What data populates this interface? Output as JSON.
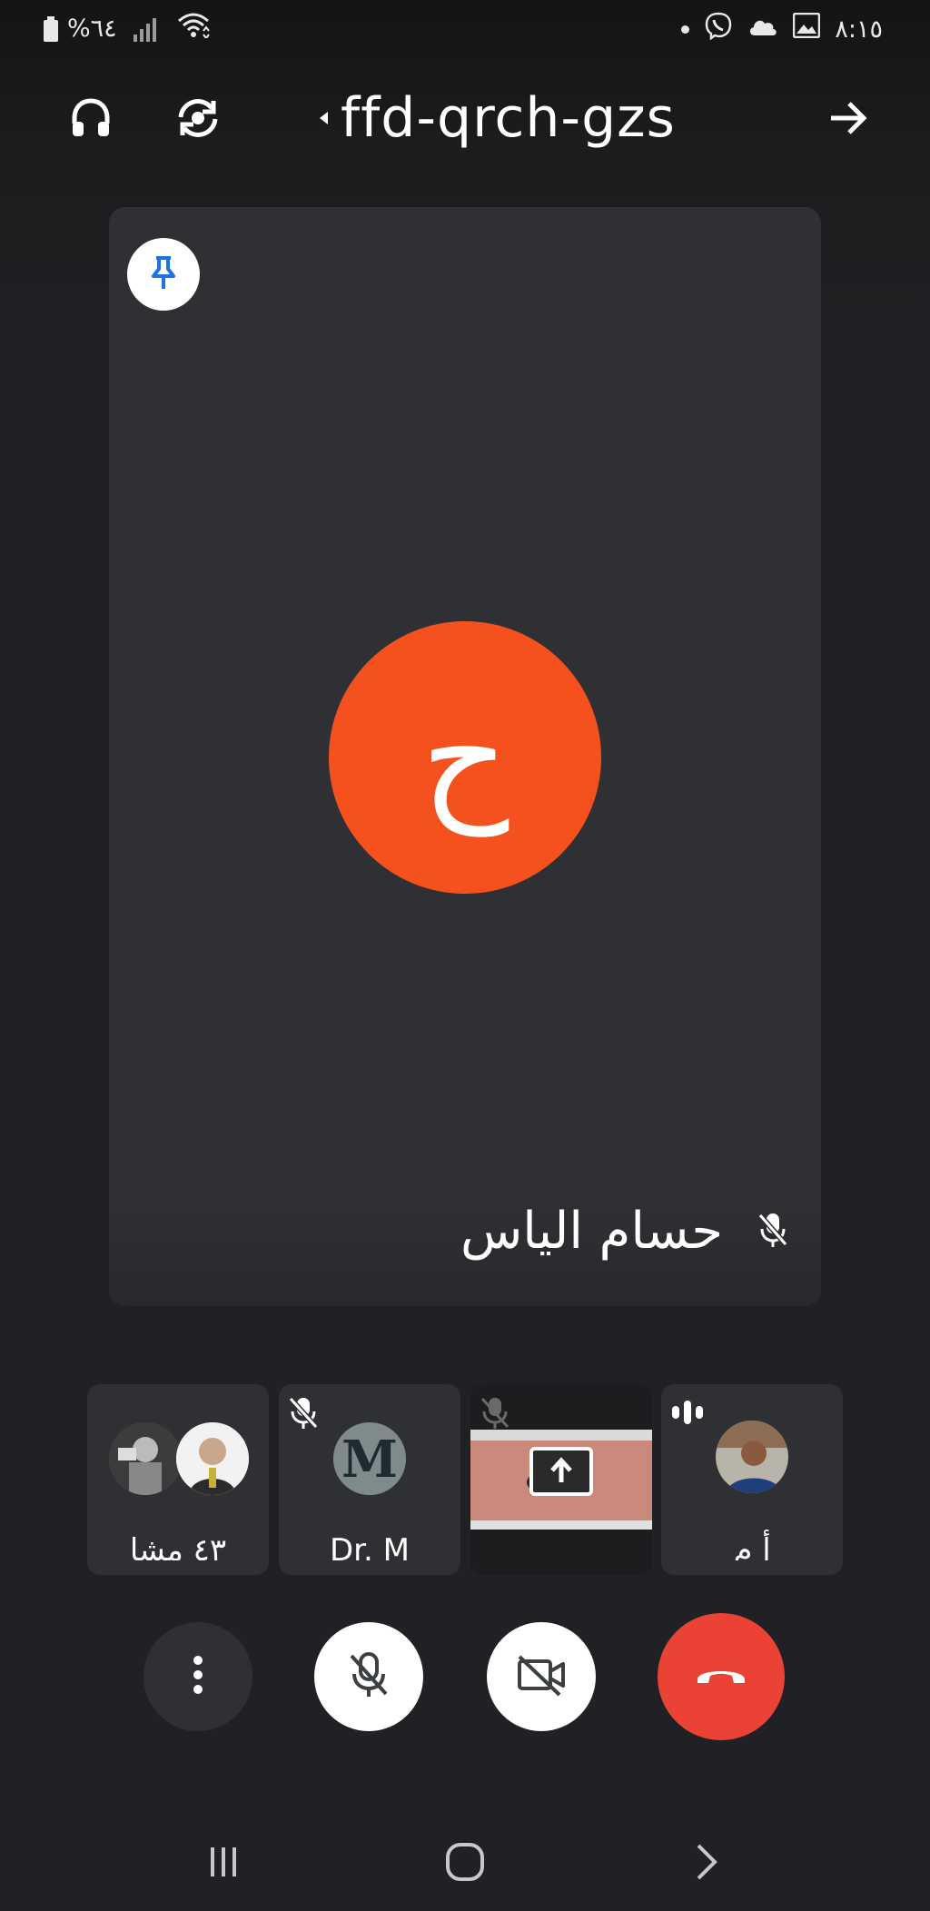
{
  "status_bar": {
    "battery_percent": "%٦٤",
    "time": "٨:١٥",
    "icons": [
      "battery-icon",
      "signal-icon",
      "wifi-icon",
      "notification-dot-icon",
      "viber-icon",
      "cloud-icon",
      "gallery-icon"
    ]
  },
  "top_bar": {
    "meeting_code": "ffd-qrch-gzs",
    "icons": [
      "headphones-icon",
      "switch-camera-icon",
      "caret-left-icon",
      "arrow-right-icon"
    ]
  },
  "main_tile": {
    "avatar_initial": "ح",
    "participant_name": "حسام الياس",
    "avatar_color": "#f4511e",
    "muted": true
  },
  "thumbnails": [
    {
      "name": "٤٣ مشا",
      "muted": false
    },
    {
      "name": "Dr. M",
      "muted": true,
      "avatar_letter": "M"
    },
    {
      "name": "",
      "muted": true,
      "presenting": true
    },
    {
      "name": "أ م",
      "muted": false,
      "speaking": true
    }
  ],
  "controls": {
    "icons": [
      "more-options-icon",
      "mic-off-icon",
      "camera-off-icon",
      "end-call-icon"
    ],
    "end_call_color": "#ea4335"
  },
  "nav_bar": {
    "icons": [
      "recent-apps-icon",
      "home-icon",
      "back-icon"
    ]
  }
}
